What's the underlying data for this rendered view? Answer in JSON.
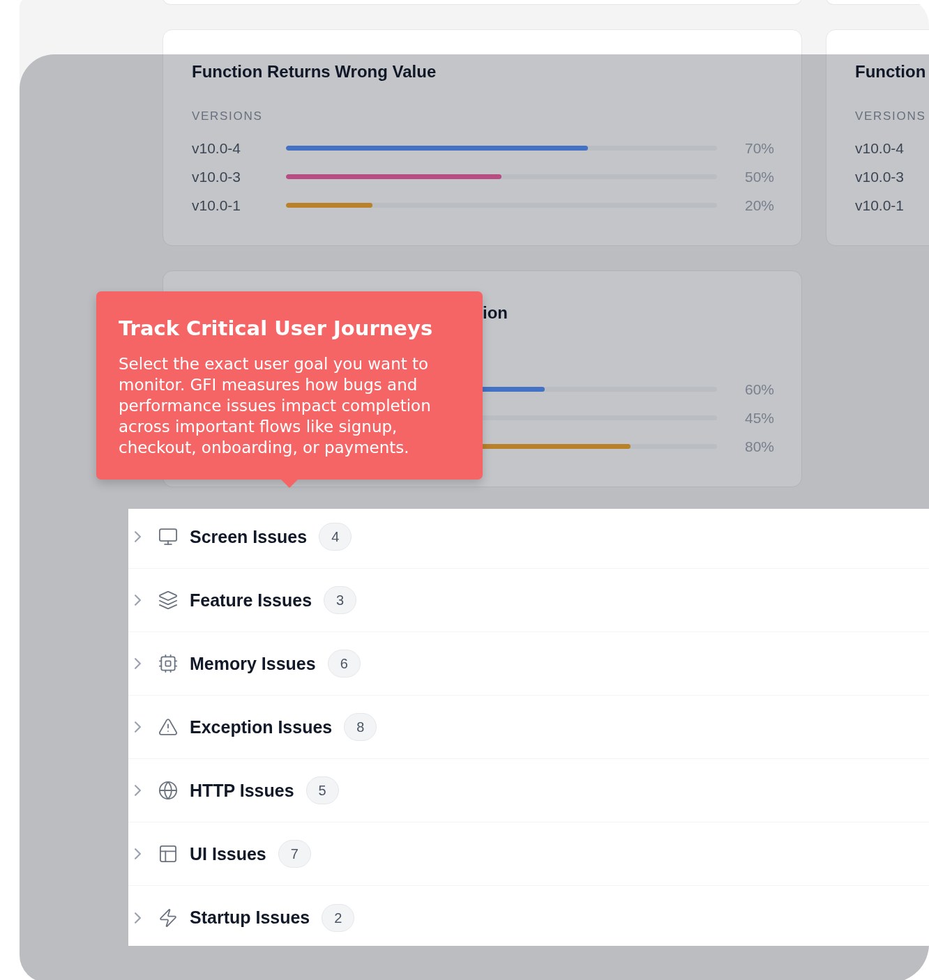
{
  "cards": [
    {
      "title": "Function Returns Wrong Value",
      "section_label": "VERSIONS",
      "rows": [
        {
          "label": "v10.0-4",
          "level": 0.7,
          "color": "#4472c4",
          "percent": "70%"
        },
        {
          "label": "v10.0-3",
          "level": 0.5,
          "color": "#b84d82",
          "percent": "50%"
        },
        {
          "label": "v10.0-1",
          "level": 0.2,
          "color": "#b8822a",
          "percent": "20%"
        }
      ]
    },
    {
      "title": "Function",
      "section_label": "VERSIONS",
      "rows": [
        {
          "label": "v10.0-4"
        },
        {
          "label": "v10.0-3"
        },
        {
          "label": "v10.0-1"
        }
      ]
    },
    {
      "title": "ion",
      "rows": [
        {
          "level": 0.6,
          "color": "#4472c4",
          "percent": "60%"
        },
        {
          "percent": "45%"
        },
        {
          "level": 0.8,
          "color": "#b8822a",
          "percent": "80%"
        }
      ]
    }
  ],
  "tooltip": {
    "title": "Track Critical User Journeys",
    "body": "Select the exact user goal you want to monitor. GFI measures how bugs and performance issues impact completion across important flows like signup, checkout, onboarding, or payments."
  },
  "issue_groups": [
    {
      "label": "Screen Issues",
      "count": "4",
      "expanded": false
    },
    {
      "label": "Feature Issues",
      "count": "3",
      "expanded": false
    },
    {
      "label": "Memory Issues",
      "count": "6",
      "expanded": false
    },
    {
      "label": "Exception Issues",
      "count": "8",
      "expanded": false
    },
    {
      "label": "HTTP Issues",
      "count": "5",
      "expanded": false
    },
    {
      "label": "UI Issues",
      "count": "7",
      "expanded": false
    },
    {
      "label": "Startup Issues",
      "count": "2",
      "expanded": false
    }
  ]
}
